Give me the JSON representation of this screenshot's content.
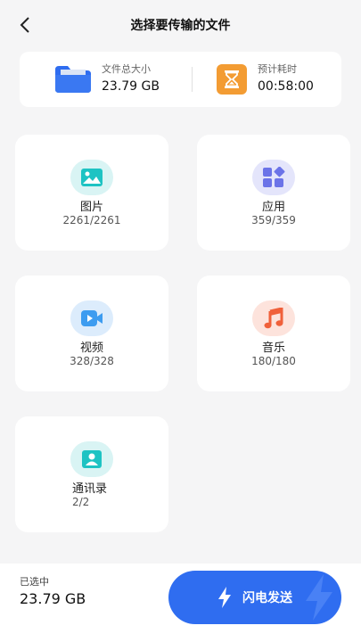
{
  "header": {
    "title": "选择要传输的文件"
  },
  "summary": {
    "size_label": "文件总大小",
    "size_value": "23.79 GB",
    "time_label": "预计耗时",
    "time_value": "00:58:00"
  },
  "categories": [
    {
      "name": "图片",
      "count": "2261/2261",
      "icon": "image-icon",
      "color": "#1ec3c3"
    },
    {
      "name": "应用",
      "count": "359/359",
      "icon": "apps-icon",
      "color": "#6b73e8"
    },
    {
      "name": "视频",
      "count": "328/328",
      "icon": "video-icon",
      "color": "#3d9cf0"
    },
    {
      "name": "音乐",
      "count": "180/180",
      "icon": "music-icon",
      "color": "#f0603a"
    },
    {
      "name": "通讯录",
      "count": "2/2",
      "icon": "contact-icon",
      "color": "#1ec3c3"
    }
  ],
  "footer": {
    "selected_label": "已选中",
    "selected_value": "23.79 GB",
    "send_label": "闪电发送"
  }
}
